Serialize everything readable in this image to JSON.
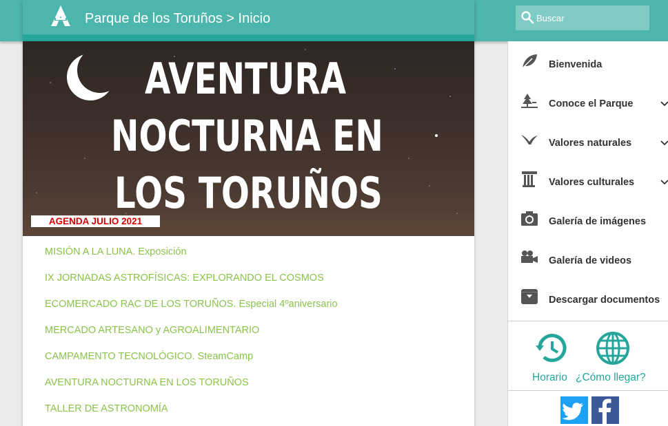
{
  "header": {
    "breadcrumb": "Parque de los Toruños > Inicio",
    "logo_icon": "junta-andalucia-logo-icon"
  },
  "search": {
    "placeholder": "Buscar",
    "icon": "search-icon"
  },
  "banner": {
    "lines": [
      "AVENTURA",
      "NOCTURNA EN",
      "LOS TORUÑOS"
    ],
    "badge": "AGENDA JULIO 2021",
    "badge_color": "#d40000",
    "moon_icon": "crescent-moon-icon"
  },
  "events": [
    "MISIÓN A LA LUNA. Exposición",
    "IX JORNADAS ASTROFÍSICAS: EXPLORANDO EL COSMOS",
    "ECOMERCADO RAC DE LOS TORUÑOS. Especial 4ºaniversario",
    "MERCADO ARTESANO y AGROALIMENTARIO",
    "CAMPAMENTO TECNOLÓGICO. SteamCamp",
    "AVENTURA NOCTURNA EN LOS TORUÑOS",
    "TALLER DE ASTRONOMÍA"
  ],
  "sidebar": {
    "items": [
      {
        "label": "Bienvenida",
        "icon": "leaf-icon",
        "expandable": false
      },
      {
        "label": "Conoce el Parque",
        "icon": "tree-icon",
        "expandable": true
      },
      {
        "label": "Valores naturales",
        "icon": "bird-icon",
        "expandable": true
      },
      {
        "label": "Valores culturales",
        "icon": "column-icon",
        "expandable": true
      },
      {
        "label": "Galería de imágenes",
        "icon": "camera-icon",
        "expandable": false
      },
      {
        "label": "Galería de videos",
        "icon": "video-camera-icon",
        "expandable": false
      },
      {
        "label": "Descargar documentos",
        "icon": "archive-download-icon",
        "expandable": false
      }
    ],
    "quick_links": [
      {
        "label": "Horario",
        "icon": "history-clock-icon"
      },
      {
        "label": "¿Cómo llegar?",
        "icon": "globe-icon"
      }
    ],
    "social": [
      {
        "icon": "twitter-icon",
        "color": "#1da1f2"
      },
      {
        "icon": "facebook-icon",
        "color": "#3b5998"
      }
    ]
  },
  "colors": {
    "primary": "#4db6ac",
    "primary_dark": "#26a69a",
    "link": "#8bc34a"
  }
}
